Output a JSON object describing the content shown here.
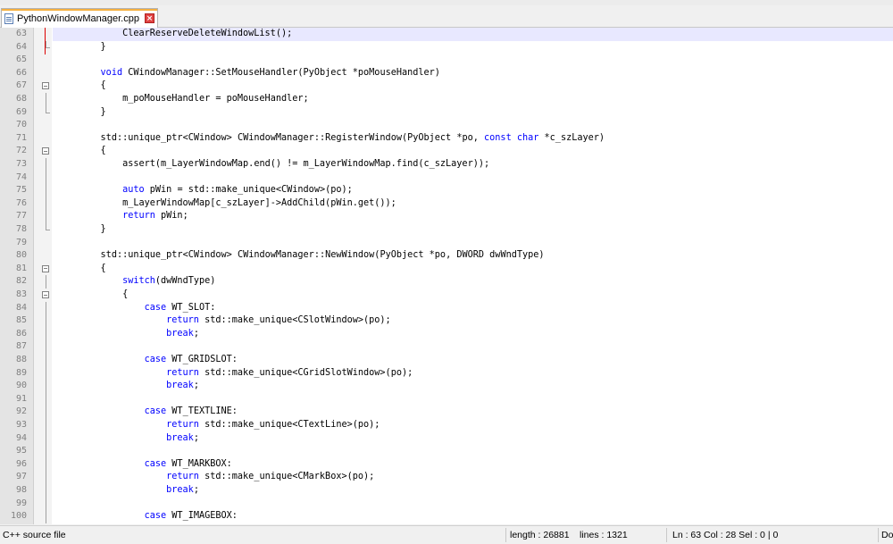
{
  "tab": {
    "filename": "PythonWindowManager.cpp",
    "close_glyph": "×"
  },
  "editor": {
    "lines": [
      {
        "n": "63",
        "t": "        ClearReserveDeleteWindowList();",
        "current": true
      },
      {
        "n": "64",
        "t": "    }"
      },
      {
        "n": "65",
        "t": ""
      },
      {
        "n": "66",
        "t": "    void CWindowManager::SetMouseHandler(PyObject *poMouseHandler)"
      },
      {
        "n": "67",
        "t": "    {"
      },
      {
        "n": "68",
        "t": "        m_poMouseHandler = poMouseHandler;"
      },
      {
        "n": "69",
        "t": "    }"
      },
      {
        "n": "70",
        "t": ""
      },
      {
        "n": "71",
        "t": "    std::unique_ptr<CWindow> CWindowManager::RegisterWindow(PyObject *po, const char *c_szLayer)"
      },
      {
        "n": "72",
        "t": "    {"
      },
      {
        "n": "73",
        "t": "        assert(m_LayerWindowMap.end() != m_LayerWindowMap.find(c_szLayer));"
      },
      {
        "n": "74",
        "t": ""
      },
      {
        "n": "75",
        "t": "        auto pWin = std::make_unique<CWindow>(po);"
      },
      {
        "n": "76",
        "t": "        m_LayerWindowMap[c_szLayer]->AddChild(pWin.get());"
      },
      {
        "n": "77",
        "t": "        return pWin;"
      },
      {
        "n": "78",
        "t": "    }"
      },
      {
        "n": "79",
        "t": ""
      },
      {
        "n": "80",
        "t": "    std::unique_ptr<CWindow> CWindowManager::NewWindow(PyObject *po, DWORD dwWndType)"
      },
      {
        "n": "81",
        "t": "    {"
      },
      {
        "n": "82",
        "t": "        switch(dwWndType)"
      },
      {
        "n": "83",
        "t": "        {"
      },
      {
        "n": "84",
        "t": "            case WT_SLOT:"
      },
      {
        "n": "85",
        "t": "                return std::make_unique<CSlotWindow>(po);"
      },
      {
        "n": "86",
        "t": "                break;"
      },
      {
        "n": "87",
        "t": ""
      },
      {
        "n": "88",
        "t": "            case WT_GRIDSLOT:"
      },
      {
        "n": "89",
        "t": "                return std::make_unique<CGridSlotWindow>(po);"
      },
      {
        "n": "90",
        "t": "                break;"
      },
      {
        "n": "91",
        "t": ""
      },
      {
        "n": "92",
        "t": "            case WT_TEXTLINE:"
      },
      {
        "n": "93",
        "t": "                return std::make_unique<CTextLine>(po);"
      },
      {
        "n": "94",
        "t": "                break;"
      },
      {
        "n": "95",
        "t": ""
      },
      {
        "n": "96",
        "t": "            case WT_MARKBOX:"
      },
      {
        "n": "97",
        "t": "                return std::make_unique<CMarkBox>(po);"
      },
      {
        "n": "98",
        "t": "                break;"
      },
      {
        "n": "99",
        "t": ""
      },
      {
        "n": "100",
        "t": "            case WT_IMAGEBOX:"
      }
    ],
    "keywords": [
      "void",
      "const",
      "char",
      "auto",
      "return",
      "switch",
      "case",
      "break"
    ]
  },
  "status": {
    "filetype": "C++ source file",
    "length": "length : 26881",
    "lines": "lines : 1321",
    "position": "Ln : 63    Col : 28    Sel : 0 | 0",
    "eol": "Do"
  },
  "colors": {
    "keyword": "#0000ff",
    "current_line": "#e8e8ff",
    "gutter": "#e4e4e4"
  }
}
